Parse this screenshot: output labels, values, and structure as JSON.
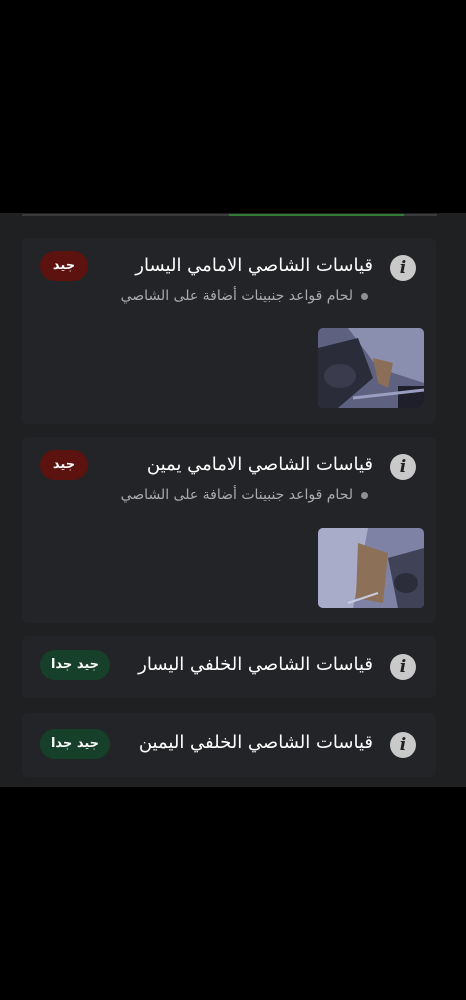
{
  "items": [
    {
      "title": "قياسات الشاصي الامامي اليسار",
      "note": "لحام قواعد جنبينات أضافة على الشاصي",
      "status": "جيد",
      "status_color": "#5c130f",
      "has_photo": true
    },
    {
      "title": "قياسات الشاصي الامامي يمين",
      "note": "لحام قواعد جنبينات أضافة على الشاصي",
      "status": "جيد",
      "status_color": "#5c130f",
      "has_photo": true
    },
    {
      "title": "قياسات الشاصي الخلفي اليسار",
      "status": "جيد جدا",
      "status_color": "#17402a"
    },
    {
      "title": "قياسات الشاصي الخلفي اليمين",
      "status": "جيد جدا",
      "status_color": "#17402a"
    }
  ],
  "icons": {
    "info": "info-icon"
  },
  "accent": "#2e7d32"
}
